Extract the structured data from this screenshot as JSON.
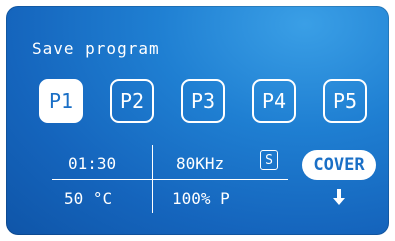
{
  "screen": {
    "title": "Save program",
    "programs": [
      {
        "label": "P1",
        "active": true
      },
      {
        "label": "P2",
        "active": false
      },
      {
        "label": "P3",
        "active": false
      },
      {
        "label": "P4",
        "active": false
      },
      {
        "label": "P5",
        "active": false
      }
    ],
    "status": {
      "time": "01:30",
      "frequency": "80KHz",
      "mode_badge": "S",
      "temperature": "50 °C",
      "power": "100% P"
    },
    "cover_label": "COVER",
    "cover_arrow_icon": "arrow-down-icon"
  },
  "colors": {
    "screen_blue": "#1f7fd2",
    "text": "#ffffff",
    "active_text": "#1a6fc6"
  }
}
